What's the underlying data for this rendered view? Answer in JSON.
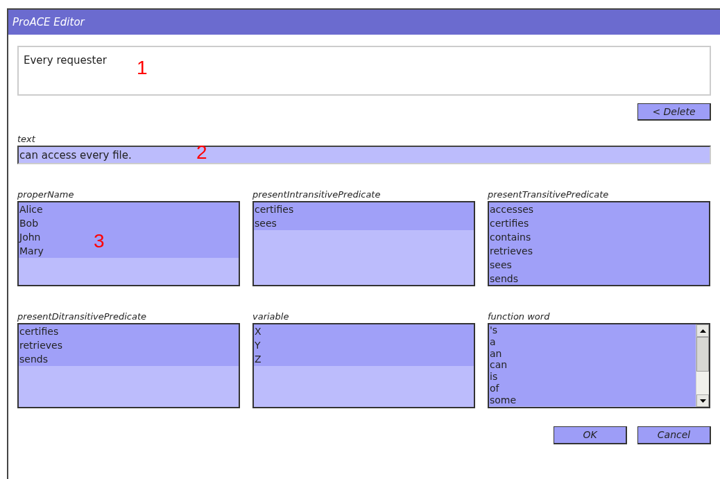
{
  "window": {
    "title": "ProACE Editor"
  },
  "sentence": {
    "value": "Every requester"
  },
  "delete_button": "< Delete",
  "text_field": {
    "label": "text",
    "value": "can access every file."
  },
  "lists": [
    {
      "label": "properName",
      "items": [
        "Alice",
        "Bob",
        "John",
        "Mary"
      ],
      "scrollbar": false
    },
    {
      "label": "presentIntransitivePredicate",
      "items": [
        "certifies",
        "sees"
      ],
      "scrollbar": false
    },
    {
      "label": "presentTransitivePredicate",
      "items": [
        "accesses",
        "certifies",
        "contains",
        "retrieves",
        "sees",
        "sends"
      ],
      "scrollbar": false
    },
    {
      "label": "presentDitransitivePredicate",
      "items": [
        "certifies",
        "retrieves",
        "sends"
      ],
      "scrollbar": false
    },
    {
      "label": "variable",
      "items": [
        "X",
        "Y",
        "Z"
      ],
      "scrollbar": false
    },
    {
      "label": "function word",
      "items": [
        "'s",
        "a",
        "an",
        "can",
        "is",
        "of",
        "some"
      ],
      "scrollbar": true
    }
  ],
  "buttons": [
    "OK",
    "Cancel"
  ],
  "annotations": [
    "1",
    "2",
    "3"
  ]
}
